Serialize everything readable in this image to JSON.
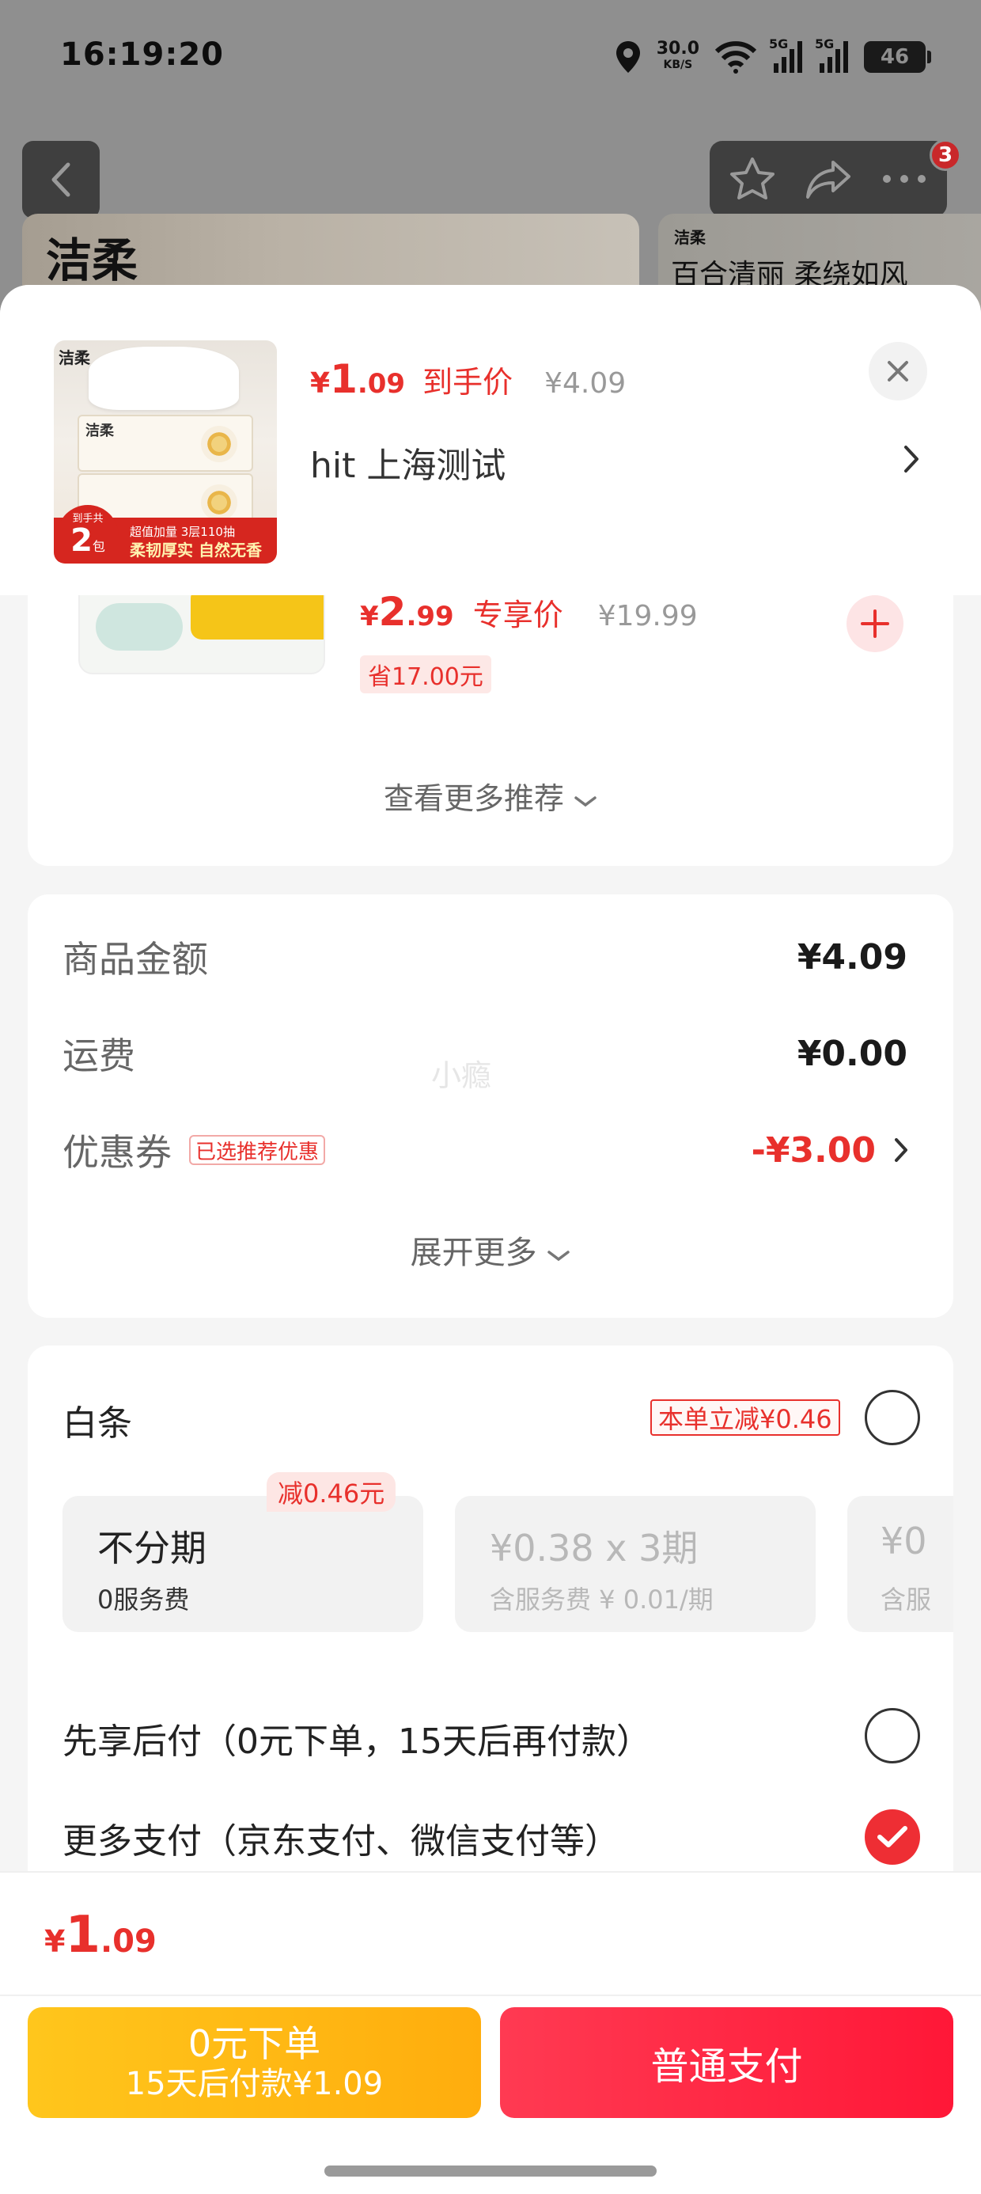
{
  "status_bar": {
    "time": "16:19:20",
    "net_speed": "30.0",
    "net_unit": "KB/S",
    "signal_label_1": "5G",
    "signal_label_2": "5G",
    "battery": "46"
  },
  "background": {
    "brand_logo": "洁柔",
    "small_logo": "洁柔",
    "slogan": "百合清丽 柔绕如风",
    "cart_badge": "3"
  },
  "product_header": {
    "thumb_logo": "洁柔",
    "thumb_pack_logo": "洁柔",
    "thumb_count_label": "到手共",
    "thumb_count": "2",
    "thumb_count_unit": "包",
    "thumb_promo_line1": "超值加量  3层110抽",
    "thumb_promo_line2": "柔韧厚实  自然无香",
    "price_symbol": "¥",
    "price_int": "1",
    "price_dec": ".09",
    "price_tag": "到手价",
    "original_price": "¥4.09",
    "address": "hit  上海测试"
  },
  "recommendation": {
    "price_symbol": "¥",
    "price_int": "2",
    "price_dec": ".99",
    "price_tag": "专享价",
    "original_price": "¥19.99",
    "savings": "省17.00元",
    "more_label": "查看更多推荐"
  },
  "summary": {
    "rows": [
      {
        "label": "商品金额",
        "value": "¥4.09"
      },
      {
        "label": "运费",
        "value": "¥0.00"
      },
      {
        "label": "优惠券",
        "tag": "已选推荐优惠",
        "value": "-¥3.00"
      }
    ],
    "watermark": "小瘾",
    "expand_label": "展开更多"
  },
  "payment": {
    "baitiao_label": "白条",
    "baitiao_promo": "本单立减¥0.46",
    "plan_badge": "减0.46元",
    "plans": [
      {
        "main": "不分期",
        "sub": "0服务费"
      },
      {
        "main": "¥0.38 x 3期",
        "sub": "含服务费 ¥ 0.01/期"
      },
      {
        "main": "¥0",
        "sub": "含服"
      }
    ],
    "options": [
      {
        "label": "先享后付（0元下单，15天后再付款）",
        "checked": false
      },
      {
        "label": "更多支付（京东支付、微信支付等）",
        "checked": true
      }
    ]
  },
  "footer": {
    "total_symbol": "¥",
    "total_int": "1",
    "total_dec": ".09",
    "later_line1": "0元下单",
    "later_line2": "15天后付款¥1.09",
    "pay_label": "普通支付"
  },
  "colors": {
    "accent_red": "#e8302c",
    "pay_button": "#ff1737",
    "later_button": "#ffb612"
  }
}
